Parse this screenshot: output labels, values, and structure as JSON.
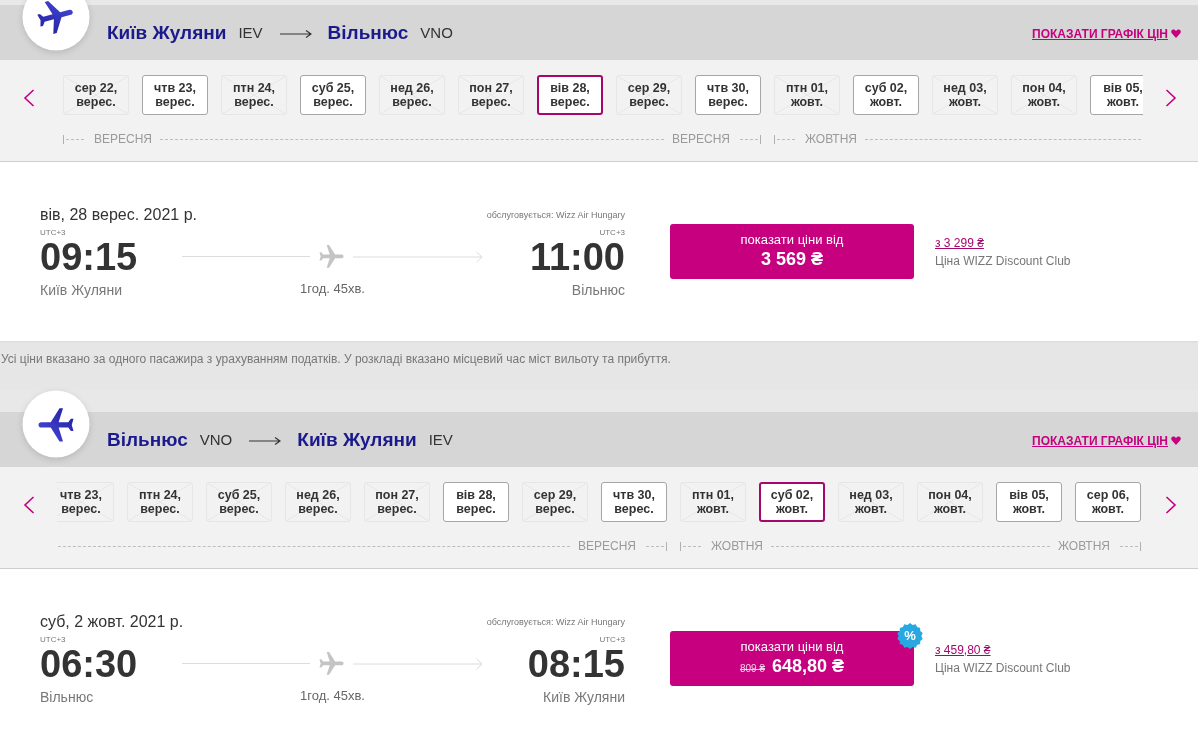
{
  "sections": [
    {
      "kind": "outbound",
      "route": {
        "from_city": "Київ Жуляни",
        "from_code": "IEV",
        "to_city": "Вільнюс",
        "to_code": "VNO"
      },
      "price_chart_link": "ПОКАЗАТИ ГРАФІК ЦІН",
      "months": [
        {
          "start_label": "ВЕРЕСНЯ",
          "end_label": "ВЕРЕСНЯ",
          "dates": [
            {
              "day": "сер 22,",
              "month": "верес.",
              "available": false,
              "selected": false
            },
            {
              "day": "чтв 23,",
              "month": "верес.",
              "available": true,
              "selected": false
            },
            {
              "day": "птн 24,",
              "month": "верес.",
              "available": false,
              "selected": false
            },
            {
              "day": "суб 25,",
              "month": "верес.",
              "available": true,
              "selected": false
            },
            {
              "day": "нед 26,",
              "month": "верес.",
              "available": false,
              "selected": false
            },
            {
              "day": "пон 27,",
              "month": "верес.",
              "available": false,
              "selected": false
            },
            {
              "day": "вів 28,",
              "month": "верес.",
              "available": true,
              "selected": true
            },
            {
              "day": "сер 29,",
              "month": "верес.",
              "available": false,
              "selected": false
            },
            {
              "day": "чтв 30,",
              "month": "верес.",
              "available": true,
              "selected": false
            }
          ]
        },
        {
          "start_label": "ЖОВТНЯ",
          "dates": [
            {
              "day": "птн 01,",
              "month": "жовт.",
              "available": false,
              "selected": false
            },
            {
              "day": "суб 02,",
              "month": "жовт.",
              "available": true,
              "selected": false
            },
            {
              "day": "нед 03,",
              "month": "жовт.",
              "available": false,
              "selected": false
            },
            {
              "day": "пон 04,",
              "month": "жовт.",
              "available": false,
              "selected": false
            },
            {
              "day": "вів 05,",
              "month": "жовт.",
              "available": true,
              "selected": false
            }
          ]
        }
      ],
      "flight": {
        "date": "вів, 28 верес. 2021 р.",
        "operator": "обслуговується: Wizz Air Hungary",
        "departure": {
          "timezone": "UTC+3",
          "time": "09:15",
          "city": "Київ Жуляни"
        },
        "arrival": {
          "timezone": "UTC+3",
          "time": "11:00",
          "city": "Вільнюс"
        },
        "duration": "1год. 45хв.",
        "price_button": {
          "label": "показати ціни від",
          "price": "3 569 ₴"
        },
        "club_price": "з 3 299 ₴",
        "club_label": "Ціна WIZZ Discount Club"
      },
      "note": "Усі ціни вказано за одного пасажира з урахуванням податків. У розкладі вказано місцевий час міст вильоту та прибуття."
    },
    {
      "kind": "return",
      "route": {
        "from_city": "Вільнюс",
        "from_code": "VNO",
        "to_city": "Київ Жуляни",
        "to_code": "IEV"
      },
      "price_chart_link": "ПОКАЗАТИ ГРАФІК ЦІН",
      "months": [
        {
          "end_label": "ВЕРЕСНЯ",
          "dates": [
            {
              "day": "чтв 23,",
              "month": "верес.",
              "available": false,
              "selected": false
            },
            {
              "day": "птн 24,",
              "month": "верес.",
              "available": false,
              "selected": false
            },
            {
              "day": "суб 25,",
              "month": "верес.",
              "available": false,
              "selected": false
            },
            {
              "day": "нед 26,",
              "month": "верес.",
              "available": false,
              "selected": false
            },
            {
              "day": "пон 27,",
              "month": "верес.",
              "available": false,
              "selected": false
            },
            {
              "day": "вів 28,",
              "month": "верес.",
              "available": true,
              "selected": false
            },
            {
              "day": "сер 29,",
              "month": "верес.",
              "available": false,
              "selected": false
            },
            {
              "day": "чтв 30,",
              "month": "верес.",
              "available": true,
              "selected": false
            }
          ]
        },
        {
          "start_label": "ЖОВТНЯ",
          "end_label": "ЖОВТНЯ",
          "dates": [
            {
              "day": "птн 01,",
              "month": "жовт.",
              "available": false,
              "selected": false
            },
            {
              "day": "суб 02,",
              "month": "жовт.",
              "available": true,
              "selected": true
            },
            {
              "day": "нед 03,",
              "month": "жовт.",
              "available": false,
              "selected": false
            },
            {
              "day": "пон 04,",
              "month": "жовт.",
              "available": false,
              "selected": false
            },
            {
              "day": "вів 05,",
              "month": "жовт.",
              "available": true,
              "selected": false
            },
            {
              "day": "сер 06,",
              "month": "жовт.",
              "available": true,
              "selected": false
            }
          ]
        }
      ],
      "flight": {
        "date": "суб, 2 жовт. 2021 р.",
        "operator": "обслуговується: Wizz Air Hungary",
        "departure": {
          "timezone": "UTC+3",
          "time": "06:30",
          "city": "Вільнюс"
        },
        "arrival": {
          "timezone": "UTC+3",
          "time": "08:15",
          "city": "Київ Жуляни"
        },
        "duration": "1год. 45хв.",
        "price_button": {
          "label": "показати ціни від",
          "old_price": "809 ₴",
          "price": "648,80 ₴"
        },
        "discount_badge": "%",
        "club_price": "з 459,80 ₴",
        "club_label": "Ціна WIZZ Discount Club"
      }
    }
  ]
}
